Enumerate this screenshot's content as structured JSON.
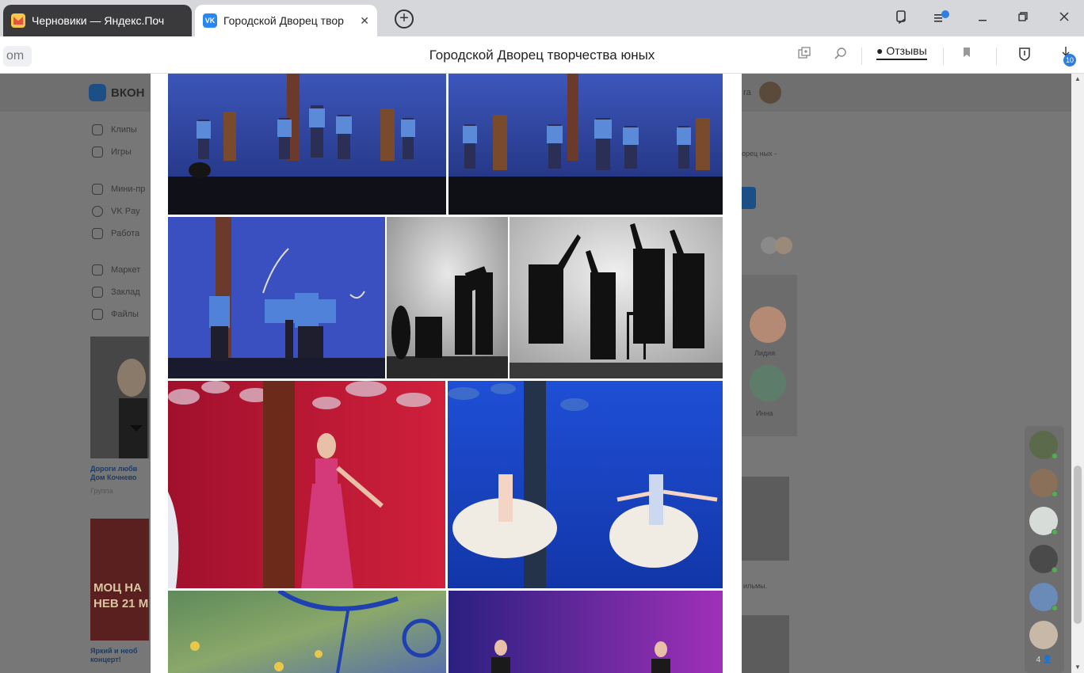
{
  "browser": {
    "tabs": [
      {
        "title": "Черновики — Яндекс.Поч",
        "icon": "mail-icon",
        "active": false
      },
      {
        "title": "Городской Дворец твор",
        "icon": "vk-icon",
        "active": true
      }
    ],
    "tab_close": "✕",
    "new_tab": "+",
    "page_title": "Городской Дворец творчества юных",
    "address_left": "om",
    "reviews_label": "Отзывы",
    "downloads_count": "10",
    "window_controls": [
      "collections-icon",
      "menu-icon",
      "minimize-icon",
      "restore-icon",
      "close-icon"
    ]
  },
  "vk": {
    "logo_text": "ВКОН",
    "sidebar": [
      {
        "label": "Клипы",
        "icon": "clips-icon"
      },
      {
        "label": "Игры",
        "icon": "games-icon"
      },
      {
        "label": "Мини-пр",
        "icon": "apps-icon"
      },
      {
        "label": "VK Pay",
        "icon": "vkpay-icon"
      },
      {
        "label": "Работа",
        "icon": "work-icon"
      },
      {
        "label": "Маркет",
        "icon": "market-icon"
      },
      {
        "label": "Заклад",
        "icon": "bookmarks-icon"
      },
      {
        "label": "Файлы",
        "icon": "files-icon"
      }
    ],
    "promo1": {
      "title": "Дороги любв Дом Кочнево",
      "sub": "Группа"
    },
    "promo2": {
      "banner": "МОЦ НА НЕВ 21 М",
      "title": "Яркий и необ концерт!"
    },
    "right_col": {
      "name_fragment": "га",
      "snippet": "орец ных -",
      "friends": [
        "Лидия",
        "Инна"
      ],
      "films": "ильмы."
    }
  },
  "album": {
    "photos": [
      {
        "desc": "cossack-dance-group-1"
      },
      {
        "desc": "cossack-dance-group-2"
      },
      {
        "desc": "sabre-dance"
      },
      {
        "desc": "shadow-theatre-1"
      },
      {
        "desc": "shadow-theatre-2"
      },
      {
        "desc": "singer-in-pink-dress"
      },
      {
        "desc": "ballet-dancers"
      },
      {
        "desc": "colorful-stage"
      },
      {
        "desc": "two-singers"
      }
    ]
  },
  "online_friends": {
    "count_label": "4 👤"
  },
  "colors": {
    "accent": "#2787f5",
    "tab_dark": "#3a3a3c",
    "badge": "#2d7fe0",
    "online": "#4bb34b"
  }
}
